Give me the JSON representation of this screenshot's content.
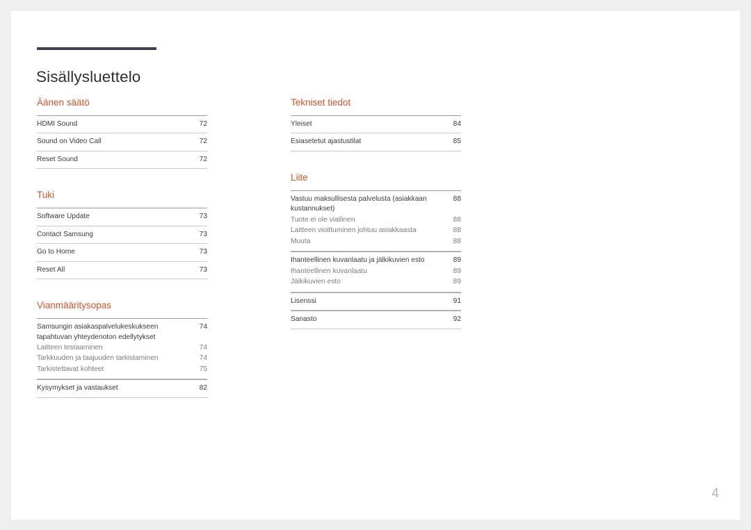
{
  "document": {
    "page_title": "Sisällysluettelo",
    "folio": "4",
    "accent_color": "#d5542c",
    "rule_color": "#3f3f4e",
    "page_background": "#ffffff",
    "canvas_background": "#efefef"
  },
  "columns": {
    "left": [
      {
        "heading": "Äänen säätö",
        "groups": [
          {
            "type": "rows",
            "rows": [
              {
                "label": "HDMI Sound",
                "page": "72"
              },
              {
                "label": "Sound on Video Call",
                "page": "72"
              },
              {
                "label": "Reset Sound",
                "page": "72"
              }
            ]
          }
        ]
      },
      {
        "heading": "Tuki",
        "groups": [
          {
            "type": "rows",
            "rows": [
              {
                "label": "Software Update",
                "page": "73"
              },
              {
                "label": "Contact Samsung",
                "page": "73"
              },
              {
                "label": "Go to Home",
                "page": "73"
              },
              {
                "label": "Reset All",
                "page": "73"
              }
            ]
          }
        ]
      },
      {
        "heading": "Vianmääritysopas",
        "groups": [
          {
            "type": "block",
            "rows": [
              {
                "label": "Samsungin asiakaspalvelukeskukseen tapahtuvan yhteydenoton edellytykset",
                "page": "74",
                "sub": false
              },
              {
                "label": "Laitteen testaaminen",
                "page": "74",
                "sub": true
              },
              {
                "label": "Tarkkuuden ja taajuuden tarkistaminen",
                "page": "74",
                "sub": true
              },
              {
                "label": "Tarkistettavat kohteet",
                "page": "75",
                "sub": true
              }
            ]
          },
          {
            "type": "rows",
            "rows": [
              {
                "label": "Kysymykset ja vastaukset",
                "page": "82"
              }
            ]
          }
        ]
      }
    ],
    "right": [
      {
        "heading": "Tekniset tiedot",
        "groups": [
          {
            "type": "rows",
            "rows": [
              {
                "label": "Yleiset",
                "page": "84"
              },
              {
                "label": "Esiasetetut ajastustilat",
                "page": "85"
              }
            ]
          }
        ]
      },
      {
        "heading": "Liite",
        "groups": [
          {
            "type": "block",
            "rows": [
              {
                "label": "Vastuu maksullisesta palvelusta (asiakkaan kustannukset)",
                "page": "88",
                "sub": false
              },
              {
                "label": "Tuote ei ole viallinen",
                "page": "88",
                "sub": true
              },
              {
                "label": "Laitteen vioittuminen johtuu asiakkaasta",
                "page": "88",
                "sub": true
              },
              {
                "label": "Muuta",
                "page": "88",
                "sub": true
              }
            ]
          },
          {
            "type": "block",
            "rows": [
              {
                "label": "Ihanteellinen kuvanlaatu ja jälkikuvien esto",
                "page": "89",
                "sub": false
              },
              {
                "label": "Ihanteellinen kuvanlaatu",
                "page": "89",
                "sub": true
              },
              {
                "label": "Jälkikuvien esto",
                "page": "89",
                "sub": true
              }
            ]
          },
          {
            "type": "rows",
            "rows": [
              {
                "label": "Lisenssi",
                "page": "91"
              }
            ]
          },
          {
            "type": "rows",
            "rows": [
              {
                "label": "Sanasto",
                "page": "92"
              }
            ]
          }
        ]
      }
    ]
  }
}
